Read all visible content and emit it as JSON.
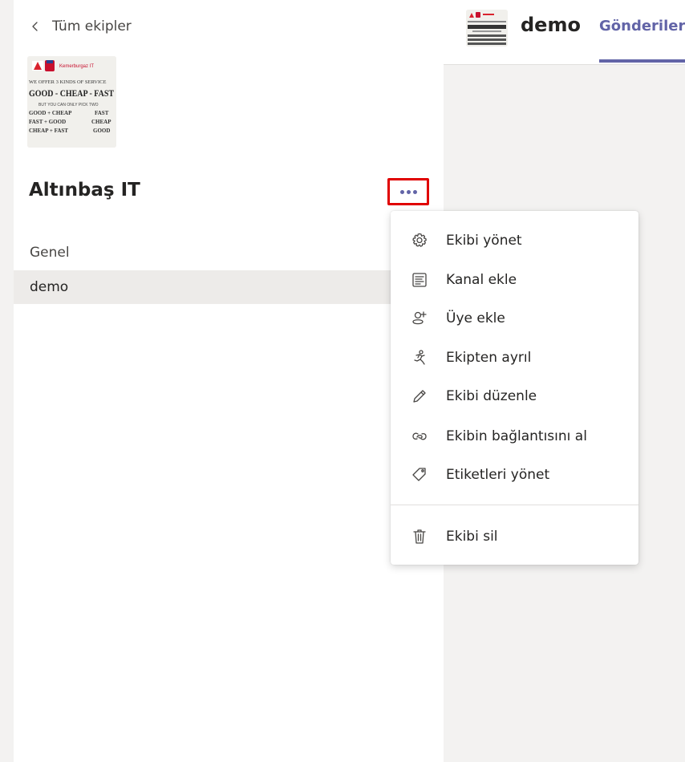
{
  "nav": {
    "back_label": "Tüm ekipler"
  },
  "team": {
    "name": "Altınbaş IT",
    "logo": {
      "brand_name": "Kemerburgaz IT",
      "line1": "WE OFFER 3 KINDS OF SERVICE",
      "line2": "GOOD - CHEAP - FAST",
      "line3": "BUT YOU CAN ONLY PICK TWO",
      "line4": "GOOD + CHEAP",
      "line5": "FAST + GOOD",
      "line6": "CHEAP + FAST",
      "result4": "FAST",
      "result5": "CHEAP",
      "result6": "GOOD"
    }
  },
  "channels": [
    {
      "label": "Genel",
      "selected": false
    },
    {
      "label": "demo",
      "selected": true
    }
  ],
  "header": {
    "channel_title": "demo",
    "tab_label": "Gönderiler"
  },
  "menu": {
    "items": [
      {
        "label": "Ekibi yönet",
        "icon": "gear-icon"
      },
      {
        "label": "Kanal ekle",
        "icon": "add-channel-icon"
      },
      {
        "label": "Üye ekle",
        "icon": "add-member-icon"
      },
      {
        "label": "Ekipten ayrıl",
        "icon": "leave-team-icon"
      },
      {
        "label": "Ekibi düzenle",
        "icon": "pencil-icon"
      },
      {
        "label": "Ekibin bağlantısını al",
        "icon": "link-icon"
      },
      {
        "label": "Etiketleri yönet",
        "icon": "tag-icon"
      },
      {
        "label": "Ekibi sil",
        "icon": "trash-icon"
      }
    ]
  },
  "colors": {
    "accent": "#6264a7",
    "highlight_border": "#e00000",
    "selected_channel_bg": "#edebe9"
  }
}
